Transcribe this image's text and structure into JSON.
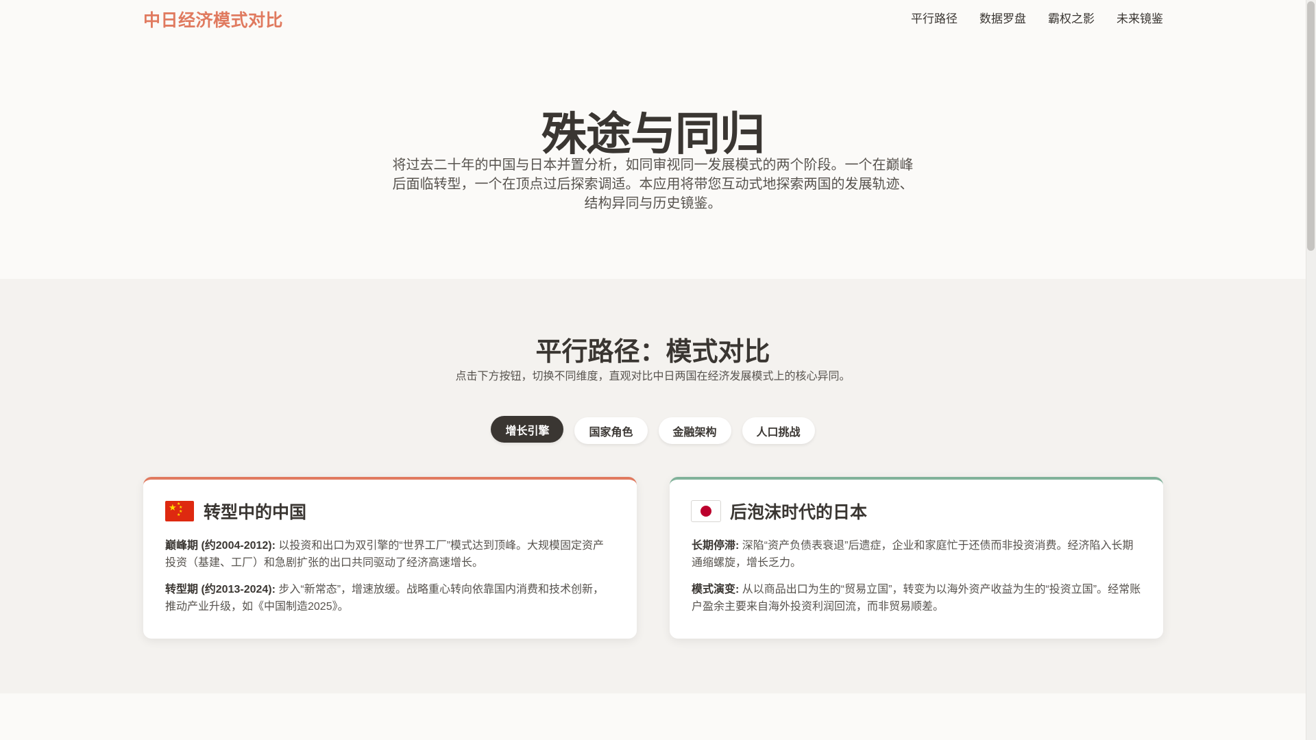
{
  "nav": {
    "brand": "中日经济模式对比",
    "links": [
      "平行路径",
      "数据罗盘",
      "霸权之影",
      "未来镜鉴"
    ]
  },
  "hero": {
    "title": "殊途与同归",
    "text": "将过去二十年的中国与日本并置分析，如同审视同一发展模式的两个阶段。一个在巅峰后面临转型，一个在顶点过后探索调适。本应用将带您互动式地探索两国的发展轨迹、结构异同与历史镜鉴。"
  },
  "section": {
    "title": "平行路径：模式对比",
    "subtitle": "点击下方按钮，切换不同维度，直观对比中日两国在经济发展模式上的核心异同。",
    "tabs": [
      {
        "label": "增长引擎",
        "active": true
      },
      {
        "label": "国家角色",
        "active": false
      },
      {
        "label": "金融架构",
        "active": false
      },
      {
        "label": "人口挑战",
        "active": false
      }
    ]
  },
  "cards": {
    "china": {
      "flag_icon": "china-flag-icon",
      "title": "转型中的中国",
      "p1_label": "巅峰期 (约2004-2012):",
      "p1_text": " 以投资和出口为双引擎的“世界工厂”模式达到顶峰。大规模固定资产投资（基建、工厂）和急剧扩张的出口共同驱动了经济高速增长。",
      "p2_label": "转型期 (约2013-2024):",
      "p2_text": " 步入“新常态”，增速放缓。战略重心转向依靠国内消费和技术创新，推动产业升级，如《中国制造2025》。"
    },
    "japan": {
      "flag_icon": "japan-flag-icon",
      "title": "后泡沫时代的日本",
      "p1_label": "长期停滞:",
      "p1_text": " 深陷“资产负债表衰退”后遗症，企业和家庭忙于还债而非投资消费。经济陷入长期通缩螺旋，增长乏力。",
      "p2_label": "模式演变:",
      "p2_text": " 从以商品出口为生的“贸易立国”，转变为以海外资产收益为生的“投资立国”。经常账户盈余主要来自海外投资利润回流，而非贸易顺差。"
    }
  },
  "colors": {
    "accent_china": "#e07a5f",
    "accent_japan": "#81b29a",
    "text_dark": "#3a3632"
  }
}
